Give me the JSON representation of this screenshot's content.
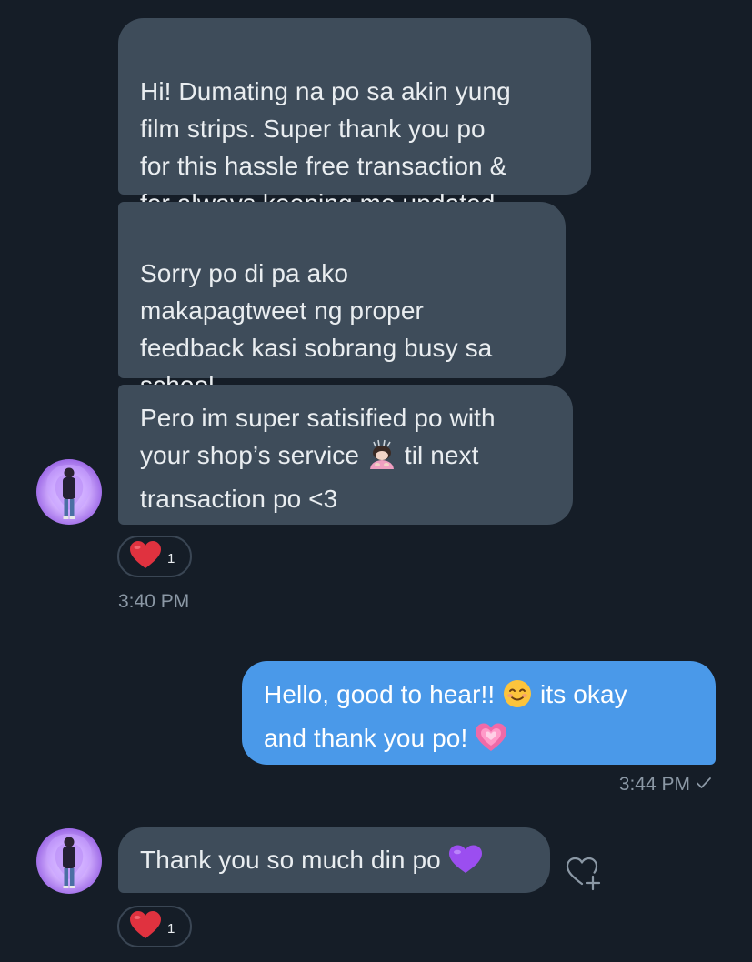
{
  "conversation": {
    "messages": [
      {
        "text": "Hi! Dumating na po sa akin yung\nfilm strips. Super thank you po\nfor this hassle free transaction &\nfor always keeping me updated"
      },
      {
        "text": "Sorry po di pa ako\nmakapagtweet ng proper\nfeedback kasi sobrang busy sa\nschool"
      },
      {
        "text_a": "Pero im super satisified po with\nyour shop’s service ",
        "emoji": "woman-bowing-emoji",
        "text_b": " til next\ntransaction po <3"
      },
      {
        "text_a": "Hello, good to hear!! ",
        "emoji_1": "smiling-face-emoji",
        "text_b": " its okay\nand thank you po! ",
        "emoji_2": "growing-heart-emoji"
      },
      {
        "text": "Thank you so much din po ",
        "emoji": "purple-heart-emoji"
      }
    ],
    "timestamps": {
      "first_group": "3:40 PM",
      "reply": "3:44 PM"
    },
    "reactions": [
      {
        "icon": "red-heart-icon",
        "count": "1"
      },
      {
        "icon": "red-heart-icon",
        "count": "1"
      }
    ],
    "icons": {
      "sent_check": "check-icon",
      "add_reaction": "heart-plus-icon",
      "avatar": "user-avatar"
    },
    "colors": {
      "background": "#151d27",
      "incoming_bubble": "#3e4c5a",
      "outgoing_bubble": "#4a99e9",
      "timestamp": "#8b98a5",
      "reaction_heart": "#e0323f"
    }
  }
}
